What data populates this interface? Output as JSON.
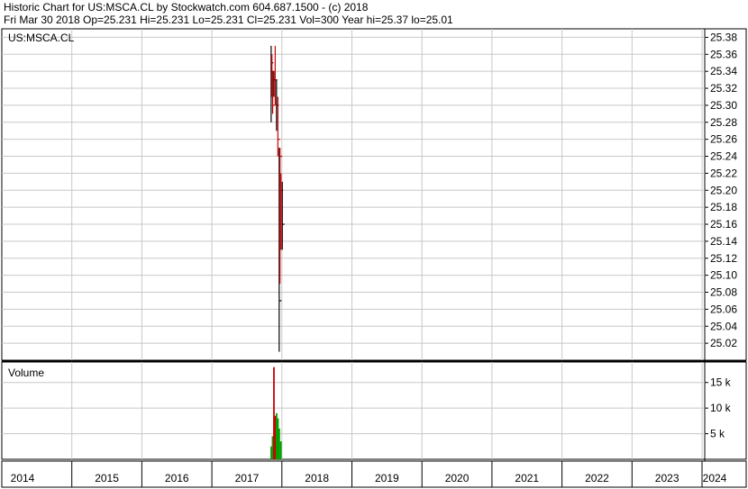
{
  "header": {
    "line1": "Historic Chart for US:MSCA.CL by Stockwatch.com 604.687.1500 - (c) 2018",
    "line2": "Fri Mar 30 2018   Op=25.231   Hi=25.231   Lo=25.231   Cl=25.231   Vol=300   Year hi=25.37   lo=25.01"
  },
  "chart_data": [
    {
      "type": "bar",
      "subtype": "ohlc",
      "label": "US:MSCA.CL",
      "x_axis": {
        "ticks": [
          "2014",
          "2015",
          "2016",
          "2017",
          "2018",
          "2019",
          "2020",
          "2021",
          "2022",
          "2023",
          "2024"
        ]
      },
      "ylim": [
        25.0,
        25.39
      ],
      "y_ticks": [
        25.02,
        25.04,
        25.06,
        25.08,
        25.1,
        25.12,
        25.14,
        25.16,
        25.18,
        25.2,
        25.22,
        25.24,
        25.26,
        25.28,
        25.3,
        25.32,
        25.34,
        25.36,
        25.38
      ],
      "grid": true,
      "colors": {
        "up": "#000000",
        "down": "#cc0000"
      },
      "bars": [
        {
          "date": "2017-11-06",
          "high": 25.37,
          "low": 25.28,
          "close": 25.35,
          "dir": "up"
        },
        {
          "date": "2017-11-10",
          "high": 25.36,
          "low": 25.31,
          "close": 25.34,
          "dir": "down"
        },
        {
          "date": "2017-11-14",
          "high": 25.34,
          "low": 25.29,
          "close": 25.3,
          "dir": "down"
        },
        {
          "date": "2017-11-20",
          "high": 25.34,
          "low": 25.31,
          "close": 25.33,
          "dir": "up"
        },
        {
          "date": "2017-11-27",
          "high": 25.37,
          "low": 25.3,
          "close": 25.33,
          "dir": "down"
        },
        {
          "date": "2017-12-04",
          "high": 25.33,
          "low": 25.27,
          "close": 25.3,
          "dir": "up"
        },
        {
          "date": "2017-12-11",
          "high": 25.31,
          "low": 25.24,
          "close": 25.26,
          "dir": "down"
        },
        {
          "date": "2017-12-18",
          "high": 25.25,
          "low": 25.01,
          "close": 25.07,
          "dir": "up"
        },
        {
          "date": "2017-12-22",
          "high": 25.25,
          "low": 25.09,
          "close": 25.24,
          "dir": "down"
        },
        {
          "date": "2017-12-27",
          "high": 25.22,
          "low": 25.13,
          "close": 25.2,
          "dir": "down"
        },
        {
          "date": "2018-01-03",
          "high": 25.21,
          "low": 25.13,
          "close": 25.16,
          "dir": "up"
        }
      ]
    },
    {
      "type": "bar",
      "label": "Volume",
      "ylim": [
        0,
        19000
      ],
      "y_ticks": [
        5000,
        10000,
        15000
      ],
      "y_tick_labels": [
        "5 k",
        "10 k",
        "15 k"
      ],
      "colors": {
        "up": "#00a000",
        "down": "#cc0000"
      },
      "bars": [
        {
          "date": "2017-11-06",
          "volume": 2500,
          "dir": "up"
        },
        {
          "date": "2017-11-13",
          "volume": 4500,
          "dir": "up"
        },
        {
          "date": "2017-11-20",
          "volume": 18000,
          "dir": "down"
        },
        {
          "date": "2017-11-27",
          "volume": 8500,
          "dir": "down"
        },
        {
          "date": "2017-12-04",
          "volume": 9000,
          "dir": "up"
        },
        {
          "date": "2017-12-11",
          "volume": 8000,
          "dir": "up"
        },
        {
          "date": "2017-12-18",
          "volume": 6000,
          "dir": "up"
        },
        {
          "date": "2017-12-26",
          "volume": 3500,
          "dir": "up"
        }
      ]
    }
  ]
}
